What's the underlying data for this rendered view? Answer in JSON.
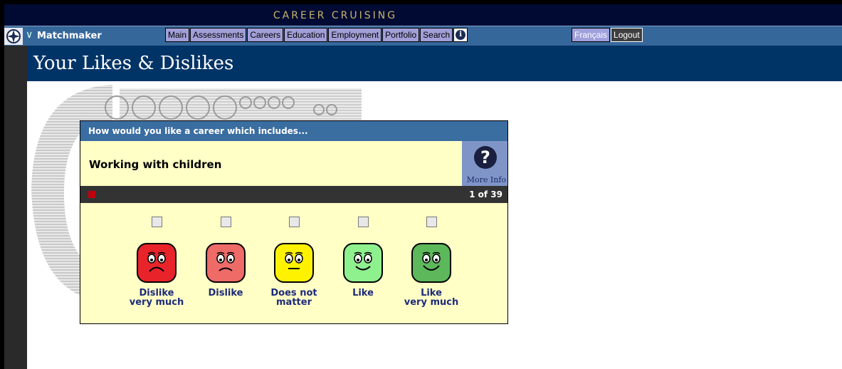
{
  "app": {
    "title": "CAREER CRUISING"
  },
  "nav": {
    "section": "Matchmaker",
    "tabs": [
      "Main",
      "Assessments",
      "Careers",
      "Education",
      "Employment",
      "Portfolio",
      "Search"
    ],
    "lang": "Français",
    "logout": "Logout"
  },
  "page": {
    "title": "Your Likes & Dislikes"
  },
  "question": {
    "prompt": "How would you like a career which includes...",
    "text": "Working with children",
    "more_info": "More Info",
    "progress": "1 of 39"
  },
  "options": [
    {
      "label_line1": "Dislike",
      "label_line2": "very much",
      "color": "#e8242a",
      "mood": "very-sad"
    },
    {
      "label_line1": "Dislike",
      "label_line2": "",
      "color": "#ee6b68",
      "mood": "sad"
    },
    {
      "label_line1": "Does not",
      "label_line2": "matter",
      "color": "#fff200",
      "mood": "neutral"
    },
    {
      "label_line1": "Like",
      "label_line2": "",
      "color": "#8ff08e",
      "mood": "happy"
    },
    {
      "label_line1": "Like",
      "label_line2": "very much",
      "color": "#5cb85a",
      "mood": "very-happy"
    }
  ],
  "colors": {
    "titlebar": "#000a33",
    "navbar": "#36679a",
    "pagetitle": "#003366",
    "card": "#ffffc6"
  }
}
